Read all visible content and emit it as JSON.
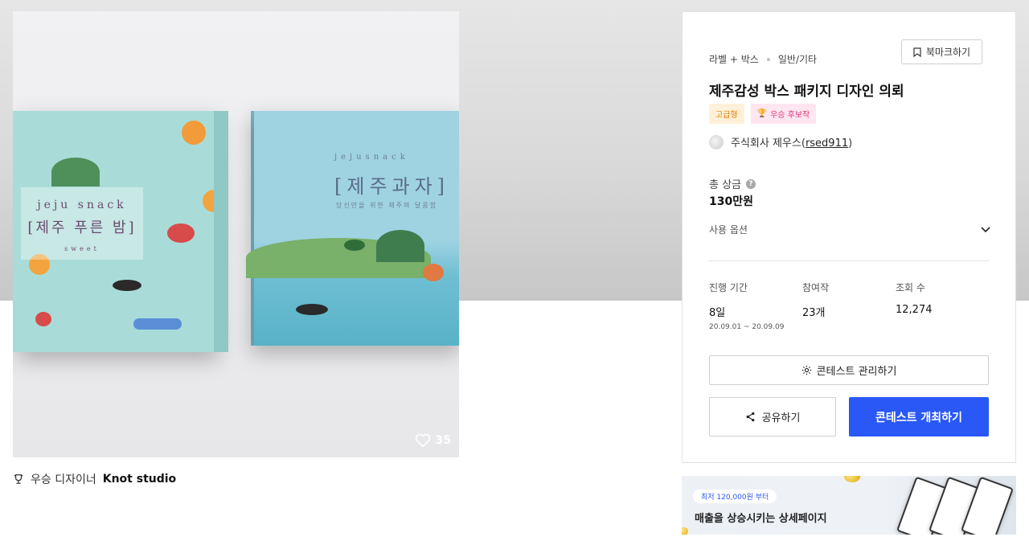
{
  "artwork": {
    "left_box": {
      "line1": "jeju snack",
      "line2": "[제주 푸른 밤]",
      "line3": "sweet"
    },
    "right_box": {
      "line1": "jejusnack",
      "line2": "[제주과자]",
      "line3": "당신만을 위한 제주의 달콤함"
    },
    "likes": "35"
  },
  "winner": {
    "prefix": "우승 디자이너",
    "name": "Knot studio"
  },
  "panel": {
    "category": "라벨 + 박스",
    "subcategory": "일반/기타",
    "bookmark_label": "북마크하기",
    "title": "제주감성 박스 패키지 디자인 의뢰",
    "tags": {
      "premium": "고급형",
      "candidate": "우승 후보작"
    },
    "host_name": "주식회사 제우스",
    "host_id": "rsed911",
    "prize_label": "총 상금",
    "prize_value": "130만원",
    "options_label": "사용 옵션",
    "stats": {
      "duration_label": "진행 기간",
      "duration_value": "8일",
      "duration_dates": "20.09.01 ~ 20.09.09",
      "entries_label": "참여작",
      "entries_value": "23개",
      "views_label": "조회 수",
      "views_value": "12,274"
    },
    "manage_label": "콘테스트 관리하기",
    "share_label": "공유하기",
    "host_contest_label": "콘테스트 개최하기"
  },
  "banner": {
    "pill": "최저 120,000원 부터",
    "headline": "매출을 상승시키는 상세페이지"
  },
  "colors": {
    "primary": "#2958f6",
    "premium_tag": "#e07b00",
    "candidate_tag": "#e2337c"
  }
}
